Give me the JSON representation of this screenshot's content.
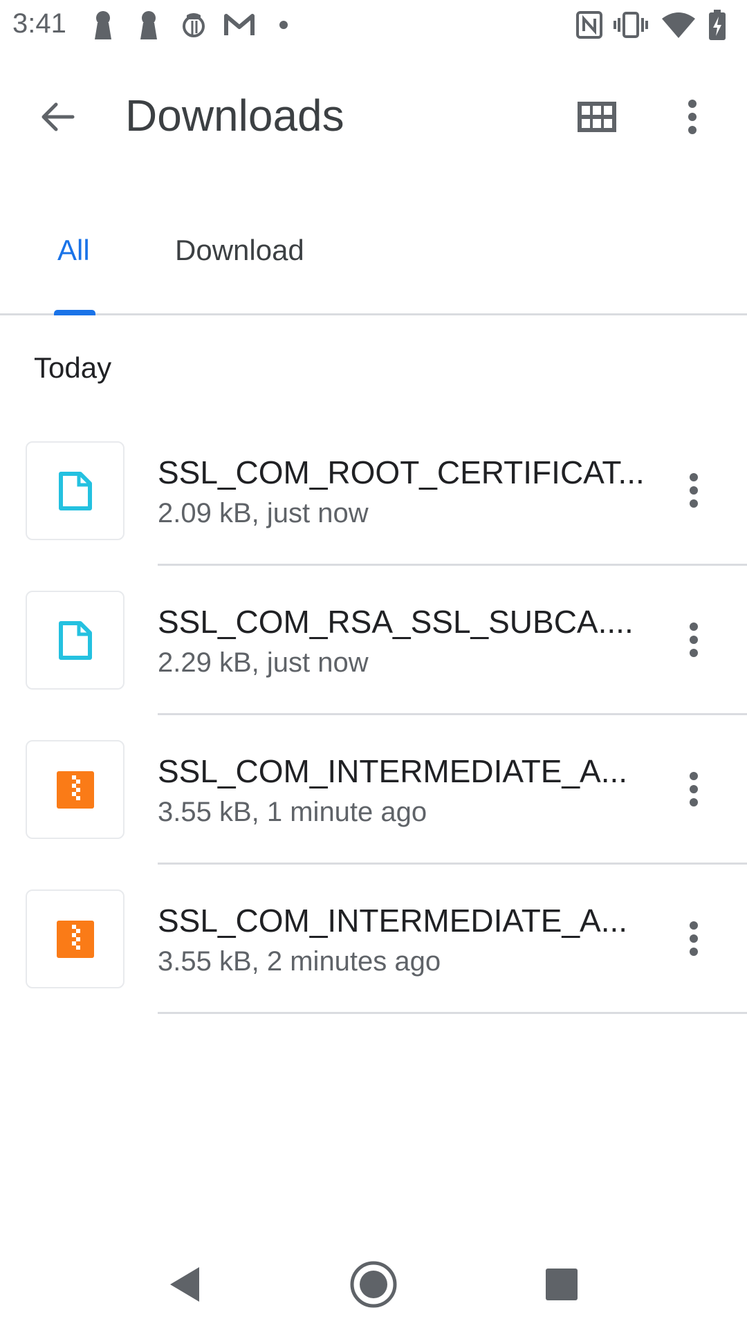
{
  "status_bar": {
    "time": "3:41",
    "left_icons": [
      "keyhole-icon",
      "keyhole-icon",
      "nytimes-icon",
      "gmail-icon",
      "dot-icon"
    ],
    "right_icons": [
      "nfc-icon",
      "vibrate-icon",
      "wifi-icon",
      "battery-charging-icon"
    ]
  },
  "app_bar": {
    "title": "Downloads",
    "back_icon": "arrow-back-icon",
    "grid_icon": "grid-view-icon",
    "more_icon": "more-vert-icon"
  },
  "tabs": [
    {
      "label": "All",
      "selected": true
    },
    {
      "label": "Download",
      "selected": false
    }
  ],
  "section": {
    "label": "Today"
  },
  "items": [
    {
      "name": "SSL_COM_ROOT_CERTIFICAT...",
      "meta": "2.09 kB, just now",
      "icon": "document-icon",
      "icon_color": "#24c1e0"
    },
    {
      "name": "SSL_COM_RSA_SSL_SUBCA....",
      "meta": "2.29 kB, just now",
      "icon": "document-icon",
      "icon_color": "#24c1e0"
    },
    {
      "name": "SSL_COM_INTERMEDIATE_A...",
      "meta": "3.55 kB, 1 minute ago",
      "icon": "archive-icon",
      "icon_color": "#fa7b17"
    },
    {
      "name": "SSL_COM_INTERMEDIATE_A...",
      "meta": "3.55 kB, 2 minutes ago",
      "icon": "archive-icon",
      "icon_color": "#fa7b17"
    }
  ],
  "nav_bar": {
    "back_icon": "nav-back-icon",
    "home_icon": "nav-home-icon",
    "recents_icon": "nav-recents-icon"
  },
  "colors": {
    "accent": "#1a73e8",
    "document": "#24c1e0",
    "archive": "#fa7b17",
    "icon_gray": "#5f6368"
  }
}
